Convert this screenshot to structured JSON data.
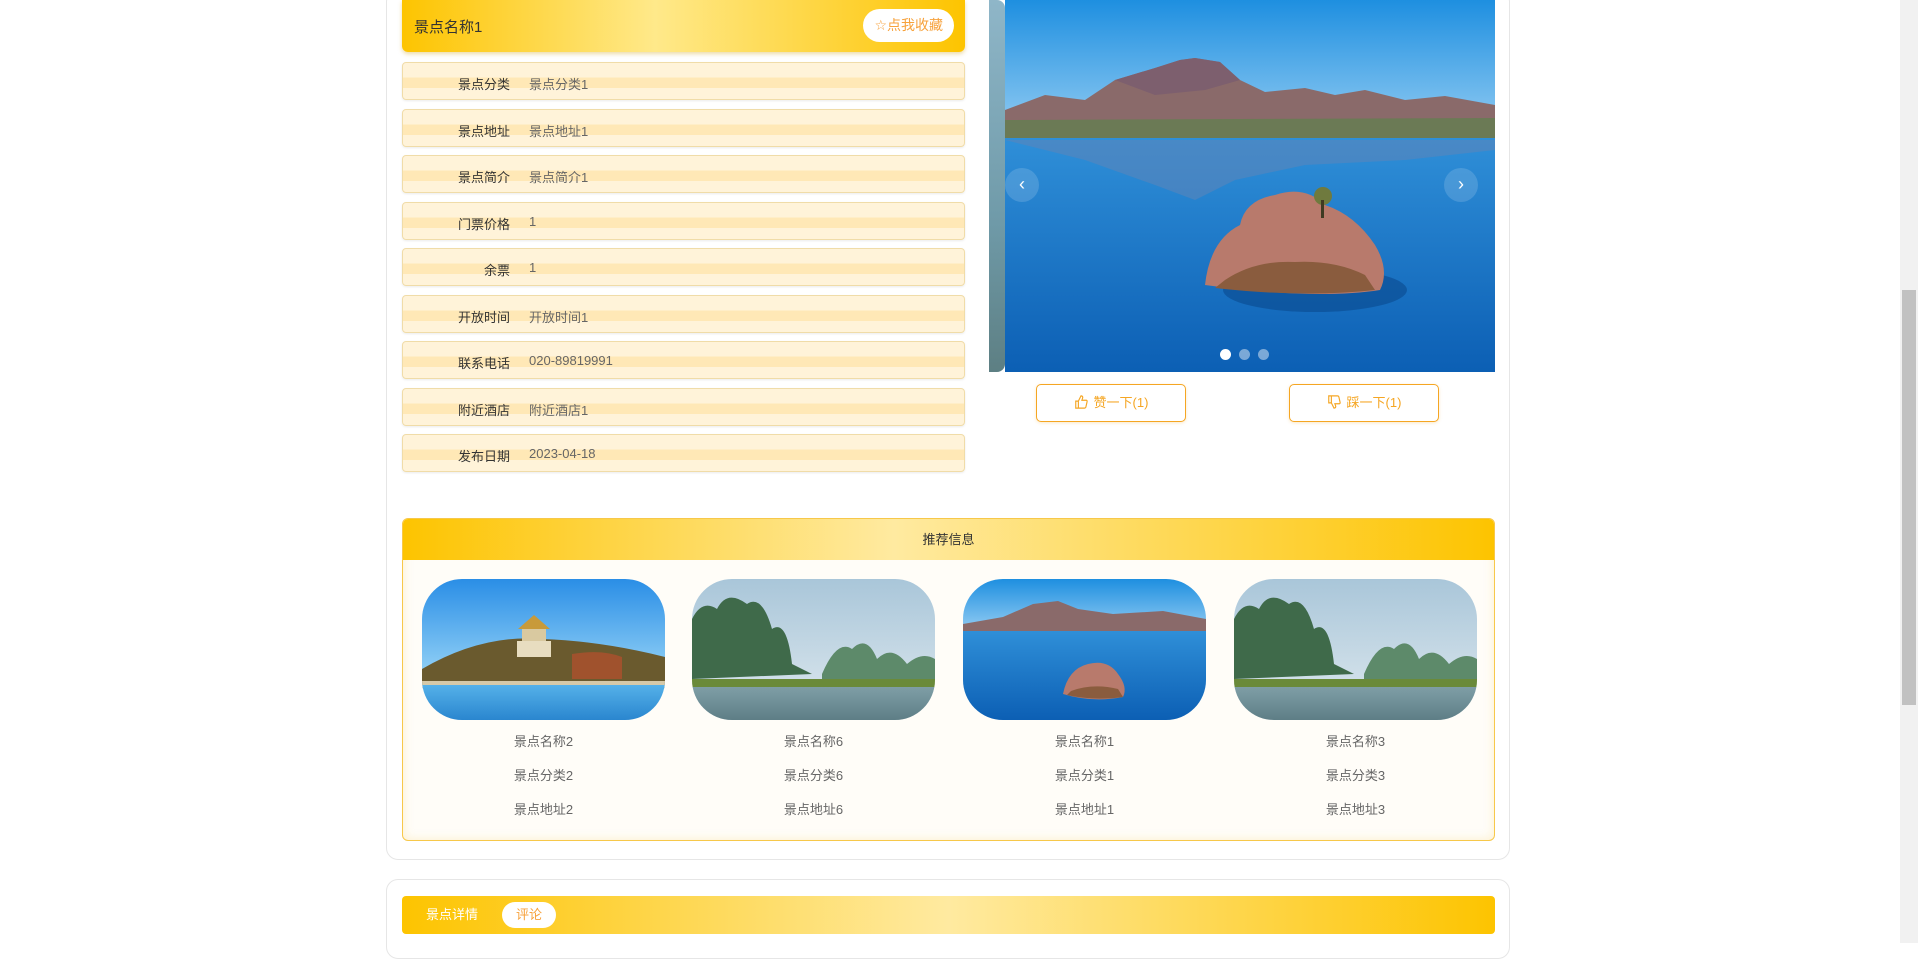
{
  "detail": {
    "title": "景点名称1",
    "favorite_label": "☆点我收藏",
    "rows": [
      {
        "label": "景点分类",
        "value": "景点分类1"
      },
      {
        "label": "景点地址",
        "value": "景点地址1"
      },
      {
        "label": "景点简介",
        "value": "景点简介1"
      },
      {
        "label": "门票价格",
        "value": "1"
      },
      {
        "label": "余票",
        "value": "1"
      },
      {
        "label": "开放时间",
        "value": "开放时间1"
      },
      {
        "label": "联系电话",
        "value": "020-89819991"
      },
      {
        "label": "附近酒店",
        "value": "附近酒店1"
      },
      {
        "label": "发布日期",
        "value": "2023-04-18"
      }
    ]
  },
  "carousel": {
    "prev_icon": "‹",
    "next_icon": "›",
    "slide_count": 3,
    "active_index": 0
  },
  "votes": {
    "like_label": "赞一下(1)",
    "dislike_label": "踩一下(1)"
  },
  "recommend": {
    "title": "推荐信息",
    "items": [
      {
        "name": "景点名称2",
        "category": "景点分类2",
        "address": "景点地址2",
        "scene": "palace"
      },
      {
        "name": "景点名称6",
        "category": "景点分类6",
        "address": "景点地址6",
        "scene": "karst"
      },
      {
        "name": "景点名称1",
        "category": "景点分类1",
        "address": "景点地址1",
        "scene": "lake"
      },
      {
        "name": "景点名称3",
        "category": "景点分类3",
        "address": "景点地址3",
        "scene": "karst"
      }
    ]
  },
  "tabs": {
    "detail_label": "景点详情",
    "comment_label": "评论"
  },
  "colors": {
    "accent": "#fdc400",
    "accent_light": "#ffe98a",
    "orange_text": "#f5a623"
  }
}
